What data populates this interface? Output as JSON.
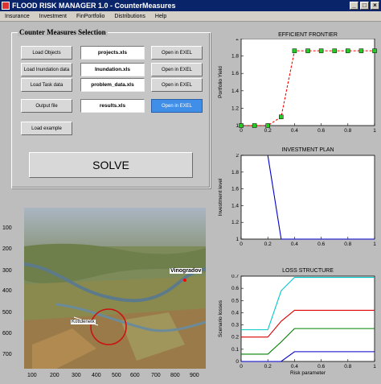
{
  "window": {
    "title": "FLOOD RISK MANAGER 1.0 - CounterMeasures"
  },
  "menu": [
    "Insurance",
    "Investment",
    "FinPortfolio",
    "Distributions",
    "Help"
  ],
  "panel": {
    "title": "Counter Measures Selection",
    "rows": [
      {
        "button": "Load Objects",
        "file": "projects.xls",
        "open": "Open in EXEL"
      },
      {
        "button": "Load Inundation data",
        "file": "Inundation.xls",
        "open": "Open in EXEL"
      },
      {
        "button": "Load Task data",
        "file": "problem_data.xls",
        "open": "Open in EXEL"
      },
      {
        "button": "Output file",
        "file": "results.xls",
        "open": "Open in EXEL"
      }
    ],
    "load_example": "Load example",
    "solve": "SOLVE"
  },
  "map": {
    "labels": {
      "town1": "Vinogradov",
      "town2": "Kottdenetk"
    },
    "y_ticks": [
      "100",
      "200",
      "300",
      "400",
      "500",
      "600",
      "700"
    ],
    "x_ticks": [
      "100",
      "200",
      "300",
      "400",
      "500",
      "600",
      "700",
      "800",
      "900"
    ]
  },
  "charts": {
    "frontier": {
      "title": "EFFICIENT FRONTIER",
      "ylabel": "Portfolio Yield"
    },
    "plan": {
      "title": "INVESTMENT PLAN",
      "ylabel": "Investment level"
    },
    "loss": {
      "title": "LOSS STRUCTURE",
      "ylabel": "Scenario losses",
      "xlabel": "Risk parameter"
    }
  },
  "chart_data": [
    {
      "type": "line",
      "title": "EFFICIENT FRONTIER",
      "ylabel": "Portfolio Yield",
      "xlim": [
        0,
        1
      ],
      "ylim": [
        1,
        2
      ],
      "xticks": [
        0,
        0.2,
        0.4,
        0.6,
        0.8,
        1
      ],
      "yticks": [
        1,
        1.2,
        1.4,
        1.6,
        1.8,
        2
      ],
      "series": [
        {
          "x": [
            0,
            0.1,
            0.2,
            0.3,
            0.4,
            0.5,
            0.6,
            0.7,
            0.8,
            0.9,
            1.0
          ],
          "y": [
            1.0,
            1.0,
            1.0,
            1.1,
            1.86,
            1.86,
            1.86,
            1.86,
            1.86,
            1.86,
            1.86
          ],
          "color": "#ff0000",
          "marker": "#22cc22"
        }
      ]
    },
    {
      "type": "line",
      "title": "INVESTMENT PLAN",
      "ylabel": "Investment level",
      "xlim": [
        0,
        1
      ],
      "ylim": [
        1,
        2
      ],
      "xticks": [
        0,
        0.2,
        0.4,
        0.6,
        0.8,
        1
      ],
      "yticks": [
        1,
        1.2,
        1.4,
        1.6,
        1.8,
        2
      ],
      "series": [
        {
          "x": [
            0.2,
            0.3,
            0.3,
            1.0
          ],
          "y": [
            2.0,
            1.0,
            1.0,
            1.0
          ],
          "color": "#0000cc"
        }
      ]
    },
    {
      "type": "line",
      "title": "LOSS STRUCTURE",
      "xlabel": "Risk parameter",
      "ylabel": "Scenario losses",
      "xlim": [
        0,
        1
      ],
      "ylim": [
        0,
        0.7
      ],
      "xticks": [
        0,
        0.2,
        0.4,
        0.6,
        0.8,
        1
      ],
      "yticks": [
        0,
        0.1,
        0.2,
        0.3,
        0.4,
        0.5,
        0.6,
        0.7
      ],
      "series": [
        {
          "x": [
            0,
            0.2,
            0.3,
            0.4,
            1.0
          ],
          "y": [
            0.26,
            0.26,
            0.58,
            0.69,
            0.69
          ],
          "color": "#00c8c8"
        },
        {
          "x": [
            0,
            0.2,
            0.3,
            0.4,
            1.0
          ],
          "y": [
            0.2,
            0.2,
            0.33,
            0.42,
            0.42
          ],
          "color": "#dd0000"
        },
        {
          "x": [
            0,
            0.2,
            0.3,
            0.4,
            1.0
          ],
          "y": [
            0.06,
            0.06,
            0.16,
            0.27,
            0.27
          ],
          "color": "#008000"
        },
        {
          "x": [
            0,
            0.3,
            0.4,
            1.0
          ],
          "y": [
            0,
            0,
            0.08,
            0.08
          ],
          "color": "#0000cc"
        }
      ]
    }
  ]
}
